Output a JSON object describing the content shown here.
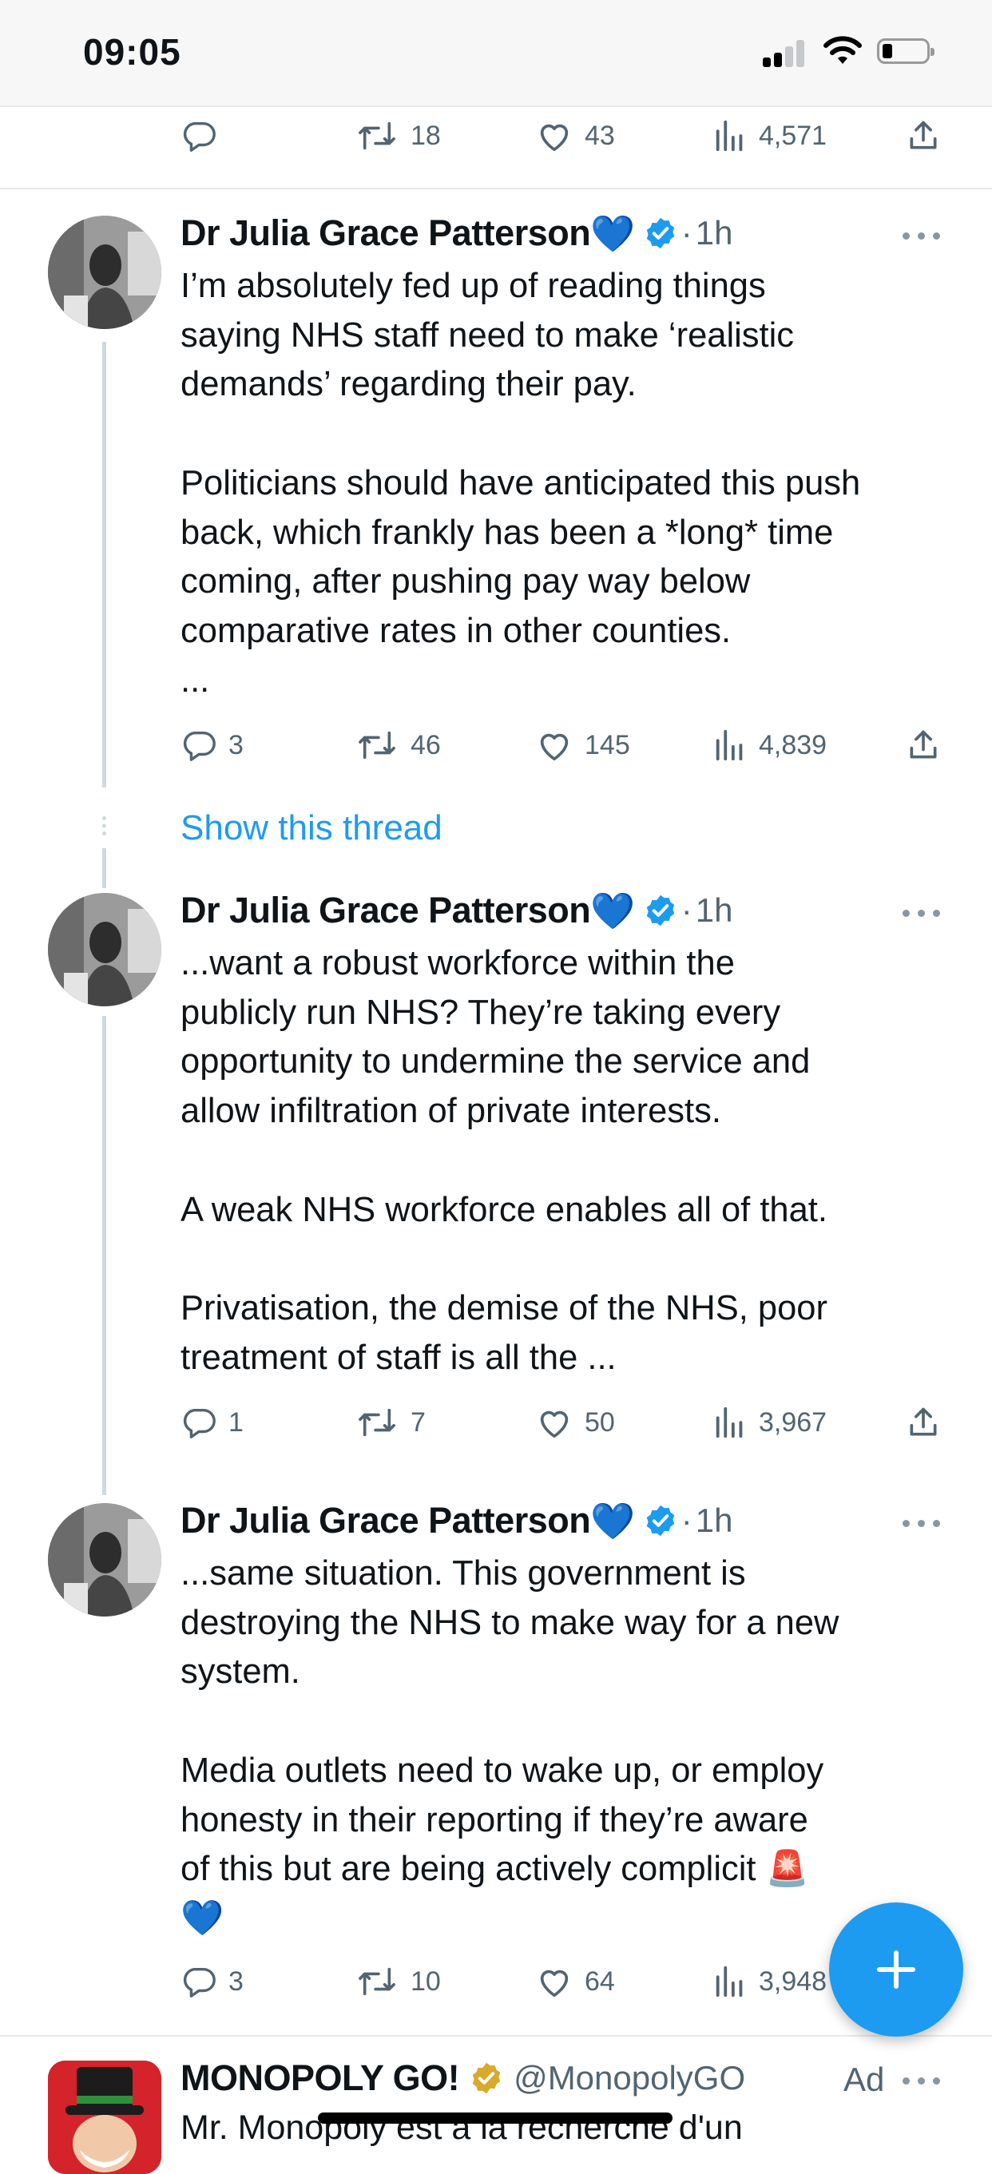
{
  "status_bar": {
    "time": "09:05"
  },
  "top_actions": {
    "reply": "",
    "retweets": "18",
    "likes": "43",
    "views": "4,571"
  },
  "tweets": [
    {
      "author": "Dr Julia Grace Patterson",
      "emoji": "💙",
      "separator": "·",
      "time": "1h",
      "lines": [
        "I’m absolutely fed up of reading things",
        "saying NHS staff need to make ‘realistic",
        "demands’ regarding their pay.",
        "",
        "Politicians should have anticipated this push",
        "back, which frankly has been a *long* time",
        "coming, after pushing pay way below",
        "comparative rates in other counties.",
        "..."
      ],
      "replies": "3",
      "retweets": "46",
      "likes": "145",
      "views": "4,839"
    },
    {
      "author": "Dr Julia Grace Patterson",
      "emoji": "💙",
      "separator": "·",
      "time": "1h",
      "lines": [
        "...want a robust workforce within the",
        "publicly run NHS? They’re taking every",
        "opportunity to undermine the service and",
        "allow infiltration of private interests.",
        "",
        "A weak NHS workforce enables all of that.",
        "",
        "Privatisation, the demise of the NHS, poor",
        "treatment of staff is all the ..."
      ],
      "replies": "1",
      "retweets": "7",
      "likes": "50",
      "views": "3,967"
    },
    {
      "author": "Dr Julia Grace Patterson",
      "emoji": "💙",
      "separator": "·",
      "time": "1h",
      "lines": [
        "...same situation. This government is",
        "destroying the NHS to make way for a new",
        "system.",
        "",
        "Media outlets need to wake up, or employ",
        "honesty in their reporting if they’re aware",
        "of this but are being actively complicit 🚨",
        "💙"
      ],
      "replies": "3",
      "retweets": "10",
      "likes": "64",
      "views": "3,948"
    }
  ],
  "show_thread": "Show this thread",
  "ad": {
    "name": "MONOPOLY GO!",
    "handle": "@MonopolyGO",
    "ad_label": "Ad",
    "text": "Mr. Monopoly est à la recherche d'un"
  },
  "colors": {
    "accent": "#1d9bf0",
    "verified": "#1d9bf0",
    "gold_verified": "#d8a92a",
    "muted": "#536471",
    "divider": "#e6e9eb"
  },
  "icons": [
    "reply-icon",
    "retweet-icon",
    "like-icon",
    "views-icon",
    "share-icon",
    "verified-badge-icon",
    "more-icon",
    "compose-plus-icon"
  ]
}
